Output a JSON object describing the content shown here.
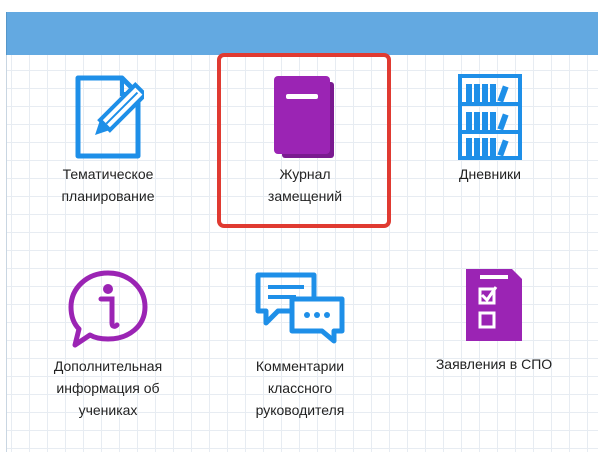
{
  "colors": {
    "header": "#63a9e1",
    "highlight": "#e03a31",
    "blue_icon": "#1e8fe8",
    "purple_icon": "#9b24b4"
  },
  "tiles": [
    {
      "label": "Тематическое\nпланирование",
      "icon": "document-pencil-icon"
    },
    {
      "label": "Журнал\nзамещений",
      "icon": "journal-book-icon"
    },
    {
      "label": "Дневники",
      "icon": "bookshelf-icon"
    },
    {
      "label": "Дополнительная\nинформация об\nучениках",
      "icon": "info-speech-icon"
    },
    {
      "label": "Комментарии\nклассного\nруководителя",
      "icon": "chat-bubbles-icon"
    },
    {
      "label": "Заявления в СПО",
      "icon": "checklist-clipboard-icon"
    }
  ]
}
